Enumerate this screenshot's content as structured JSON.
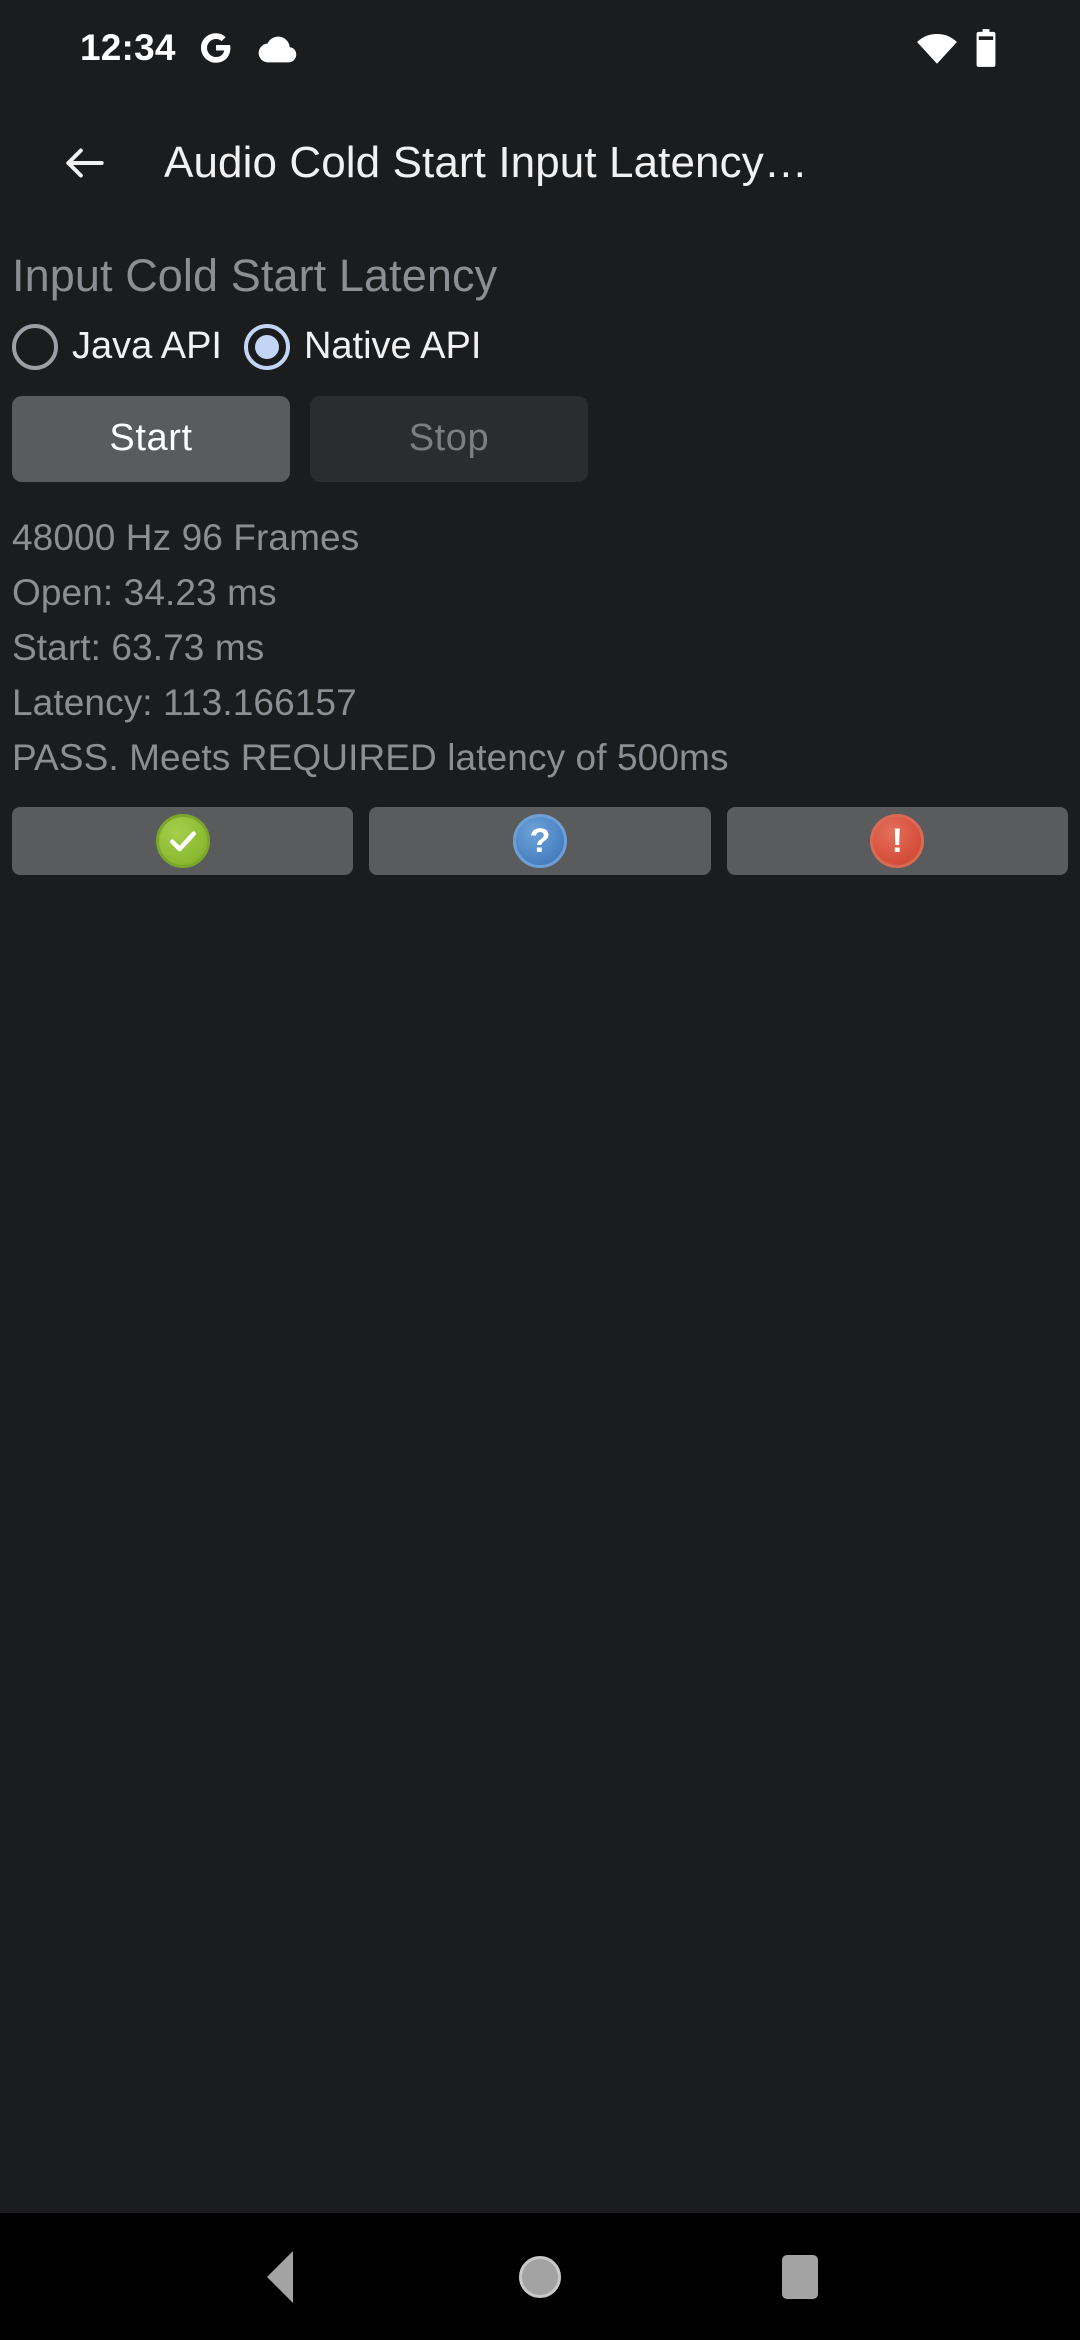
{
  "status_bar": {
    "clock": "12:34",
    "icons": [
      {
        "name": "google-g-icon"
      },
      {
        "name": "cloud-icon"
      }
    ],
    "right_icons": [
      {
        "name": "wifi-icon"
      },
      {
        "name": "battery-icon"
      }
    ]
  },
  "app_bar": {
    "back_label": "back-arrow",
    "title": "Audio Cold Start Input Latency…"
  },
  "main": {
    "heading": "Input Cold Start Latency",
    "radio_options": [
      {
        "label": "Java API",
        "selected": false
      },
      {
        "label": "Native API",
        "selected": true
      }
    ],
    "buttons": {
      "start_label": "Start",
      "stop_label": "Stop"
    },
    "results": [
      "48000 Hz 96 Frames",
      "Open: 34.23 ms",
      "Start: 63.73 ms",
      "Latency: 113.166157",
      "PASS. Meets REQUIRED latency of 500ms"
    ],
    "verdict_buttons": [
      {
        "name": "pass-button",
        "glyph": "✓",
        "color": "#8cbb33"
      },
      {
        "name": "info-button",
        "glyph": "?",
        "color": "#4a83c4"
      },
      {
        "name": "fail-button",
        "glyph": "!",
        "color": "#d64f3a"
      }
    ]
  },
  "nav_bar": {
    "back": "back",
    "home": "home",
    "recents": "recents"
  },
  "colors": {
    "background": "#1b1c1e",
    "nav_background": "#000000",
    "heading": "#8b8e92",
    "accent": "#c3d5f5"
  }
}
